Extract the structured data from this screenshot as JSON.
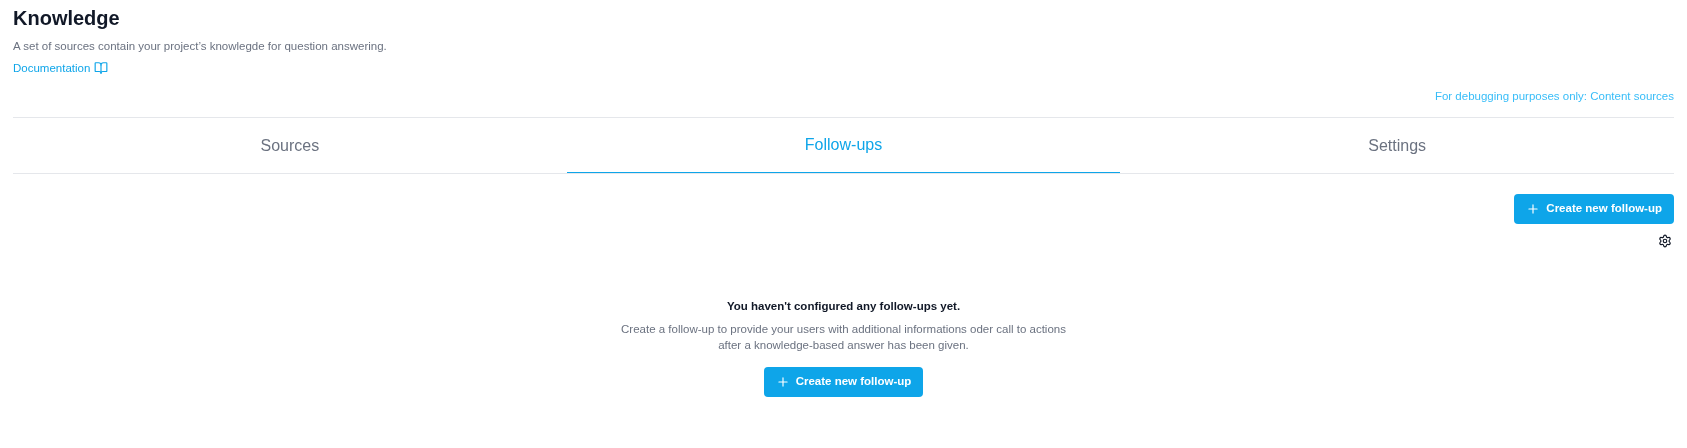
{
  "header": {
    "title": "Knowledge",
    "description": "A set of sources contain your project’s knowlegde for question answering.",
    "doc_link": "Documentation"
  },
  "debug_link": "For debugging purposes only: Content sources",
  "tabs": [
    {
      "label": "Sources",
      "selected": false
    },
    {
      "label": "Follow-ups",
      "selected": true
    },
    {
      "label": "Settings",
      "selected": false
    }
  ],
  "toolbar": {
    "create_button": "Create new follow-up"
  },
  "empty_state": {
    "title": "You haven't configured any follow-ups yet.",
    "description_lines": [
      "Create a follow-up to provide your users with additional informations oder call to actions",
      "after a knowledge-based answer has been given."
    ],
    "create_button": "Create new follow-up"
  }
}
